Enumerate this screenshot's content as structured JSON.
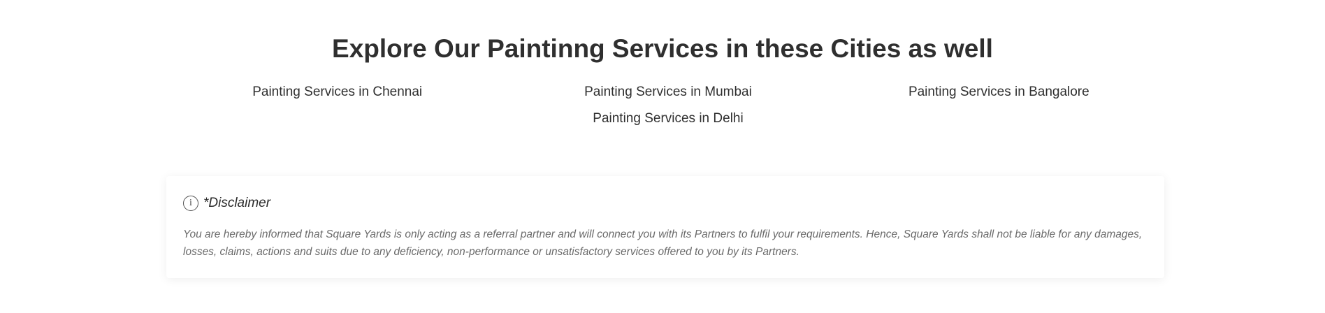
{
  "section": {
    "heading": "Explore Our Paintinng Services in these Cities as well",
    "cities": [
      "Painting Services in Chennai",
      "Painting Services in Mumbai",
      "Painting Services in Bangalore",
      "Painting Services in Delhi"
    ]
  },
  "disclaimer": {
    "icon": "info-icon",
    "icon_glyph": "i",
    "title": "*Disclaimer",
    "text": "You are hereby informed that Square Yards is only acting as a referral partner and will connect you with its Partners to fulfil your requirements. Hence, Square Yards shall not be liable for any damages, losses, claims, actions and suits due to any deficiency, non-performance or unsatisfactory services offered to you by its Partners."
  }
}
